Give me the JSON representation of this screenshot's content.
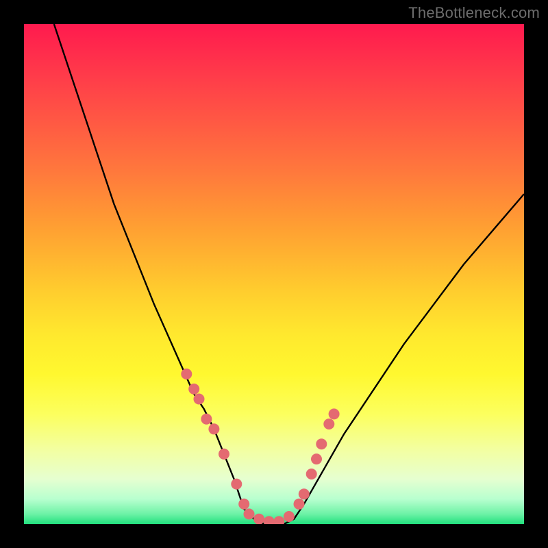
{
  "watermark": "TheBottleneck.com",
  "chart_data": {
    "type": "line",
    "title": "",
    "xlabel": "",
    "ylabel": "",
    "xlim": [
      0,
      100
    ],
    "ylim": [
      0,
      100
    ],
    "series": [
      {
        "name": "bottleneck-curve",
        "x": [
          6,
          10,
          14,
          18,
          22,
          26,
          30,
          34,
          36,
          38,
          40,
          42,
          43,
          44,
          46,
          48,
          50,
          52,
          54,
          56,
          60,
          64,
          70,
          76,
          82,
          88,
          94,
          100
        ],
        "y": [
          100,
          88,
          76,
          64,
          54,
          44,
          35,
          26,
          23,
          19,
          14,
          9,
          6,
          3,
          1,
          0,
          0,
          0,
          1,
          4,
          11,
          18,
          27,
          36,
          44,
          52,
          59,
          66
        ]
      }
    ],
    "markers": {
      "name": "highlight-dots",
      "x": [
        32.5,
        34,
        35,
        36.5,
        38,
        40,
        42.5,
        44,
        45,
        47,
        49,
        51,
        53,
        55,
        56,
        57.5,
        58.5,
        59.5,
        61,
        62
      ],
      "y": [
        30,
        27,
        25,
        21,
        19,
        14,
        8,
        4,
        2,
        1,
        0.5,
        0.5,
        1.5,
        4,
        6,
        10,
        13,
        16,
        20,
        22
      ]
    },
    "colors": {
      "curve": "#000000",
      "markers": "#e46a71",
      "gradient_top": "#ff1a4e",
      "gradient_bottom": "#22e07e"
    }
  }
}
